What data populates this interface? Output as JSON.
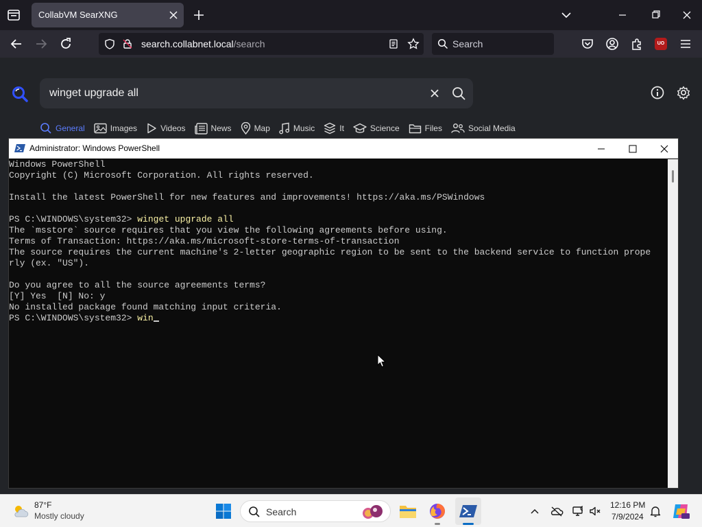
{
  "browser": {
    "tab": {
      "title": "CollabVM SearXNG"
    },
    "url": {
      "host": "search.collabnet.local",
      "path": "/search"
    },
    "search_placeholder": "Search",
    "ublock_badge": "UO"
  },
  "searx": {
    "query": "winget upgrade all",
    "categories": [
      {
        "label": "General",
        "icon": "search-icon",
        "active": true
      },
      {
        "label": "Images",
        "icon": "image-icon"
      },
      {
        "label": "Videos",
        "icon": "play-icon"
      },
      {
        "label": "News",
        "icon": "newspaper-icon"
      },
      {
        "label": "Map",
        "icon": "map-pin-icon"
      },
      {
        "label": "Music",
        "icon": "music-note-icon"
      },
      {
        "label": "It",
        "icon": "layers-icon"
      },
      {
        "label": "Science",
        "icon": "graduation-cap-icon"
      },
      {
        "label": "Files",
        "icon": "files-icon"
      },
      {
        "label": "Social Media",
        "icon": "people-icon"
      }
    ],
    "accent": "#5c7dff"
  },
  "powershell": {
    "title": "Administrator: Windows PowerShell",
    "lines": [
      "Windows PowerShell",
      "Copyright (C) Microsoft Corporation. All rights reserved.",
      "",
      "Install the latest PowerShell for new features and improvements! https://aka.ms/PSWindows",
      "",
      "PS C:\\WINDOWS\\system32> ",
      "The `msstore` source requires that you view the following agreements before using.",
      "Terms of Transaction: https://aka.ms/microsoft-store-terms-of-transaction",
      "The source requires the current machine's 2-letter geographic region to be sent to the backend service to function prope",
      "rly (ex. \"US\").",
      "",
      "Do you agree to all the source agreements terms?",
      "[Y] Yes  [N] No: y",
      "No installed package found matching input criteria.",
      "PS C:\\WINDOWS\\system32> "
    ],
    "prompt_cmd_1": "winget upgrade all",
    "prompt_cmd_2": "win",
    "command_color": "#f9f1a5"
  },
  "taskbar": {
    "weather": {
      "temp": "87°F",
      "desc": "Mostly cloudy"
    },
    "search_label": "Search",
    "clock": {
      "time": "12:16 PM",
      "date": "7/9/2024"
    }
  }
}
